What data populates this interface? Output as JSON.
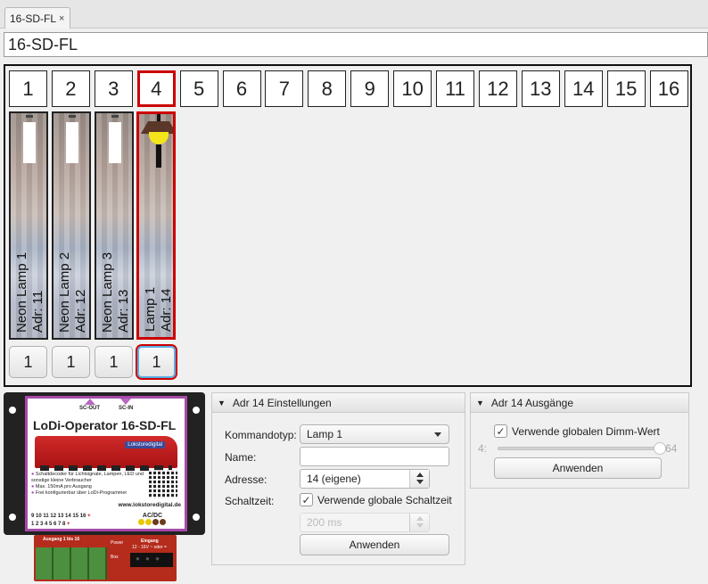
{
  "tab": {
    "label": "16-SD-FL",
    "close": "×"
  },
  "title_field": "16-SD-FL",
  "channel_numbers": [
    "1",
    "2",
    "3",
    "4",
    "5",
    "6",
    "7",
    "8",
    "9",
    "10",
    "11",
    "12",
    "13",
    "14",
    "15",
    "16"
  ],
  "active_channel": "4",
  "channels": [
    {
      "name": "Neon Lamp 1",
      "addr": "Adr: 11",
      "value": "1",
      "icon": "neon-tube-icon"
    },
    {
      "name": "Neon Lamp 2",
      "addr": "Adr: 12",
      "value": "1",
      "icon": "neon-tube-icon"
    },
    {
      "name": "Neon Lamp 3",
      "addr": "Adr: 13",
      "value": "1",
      "icon": "neon-tube-icon"
    },
    {
      "name": "Lamp 1",
      "addr": "Adr: 14",
      "value": "1",
      "icon": "street-lamp-icon"
    }
  ],
  "decoder": {
    "sc_out": "SC-OUT",
    "sc_in": "SC-IN",
    "title": "LoDi-Operator  16-SD-FL",
    "brand": "Lokstoredigital",
    "features": [
      "Schaltdecoder für Lichtsignale, Lampen, LED und sonstige kleine Verbraucher",
      "Max. 150mA pro Ausgang",
      "Frei konfigurierbar über LoDi-Programmer"
    ],
    "website": "www.lokstoredigital.de",
    "pins_top": "9 10 11 12 13 14 15 16",
    "pins_bottom": "1  2  3  4  5  6  7  8",
    "pins_plus": "+",
    "acdc": "AC/DC",
    "terminal_left": "Ausgang 1 bis 16",
    "terminal_power": "Power",
    "terminal_box": "Box",
    "terminal_in": "Eingang",
    "terminal_spec": "12 - 16V ~ oder ="
  },
  "settings": {
    "header": "Adr 14 Einstellungen",
    "kommandotyp_label": "Kommandotyp:",
    "kommandotyp_value": "Lamp 1",
    "name_label": "Name:",
    "name_value": "",
    "adresse_label": "Adresse:",
    "adresse_value": "14 (eigene)",
    "schaltzeit_label": "Schaltzeit:",
    "global_schaltzeit": "Verwende globale Schaltzeit",
    "schaltzeit_value": "200 ms",
    "apply": "Anwenden"
  },
  "outputs": {
    "header": "Adr 14 Ausgänge",
    "global_dimm": "Verwende globalen Dimm-Wert",
    "slider_min": "4:",
    "slider_max": "64",
    "slider_value_fraction": 1.0,
    "apply": "Anwenden"
  }
}
